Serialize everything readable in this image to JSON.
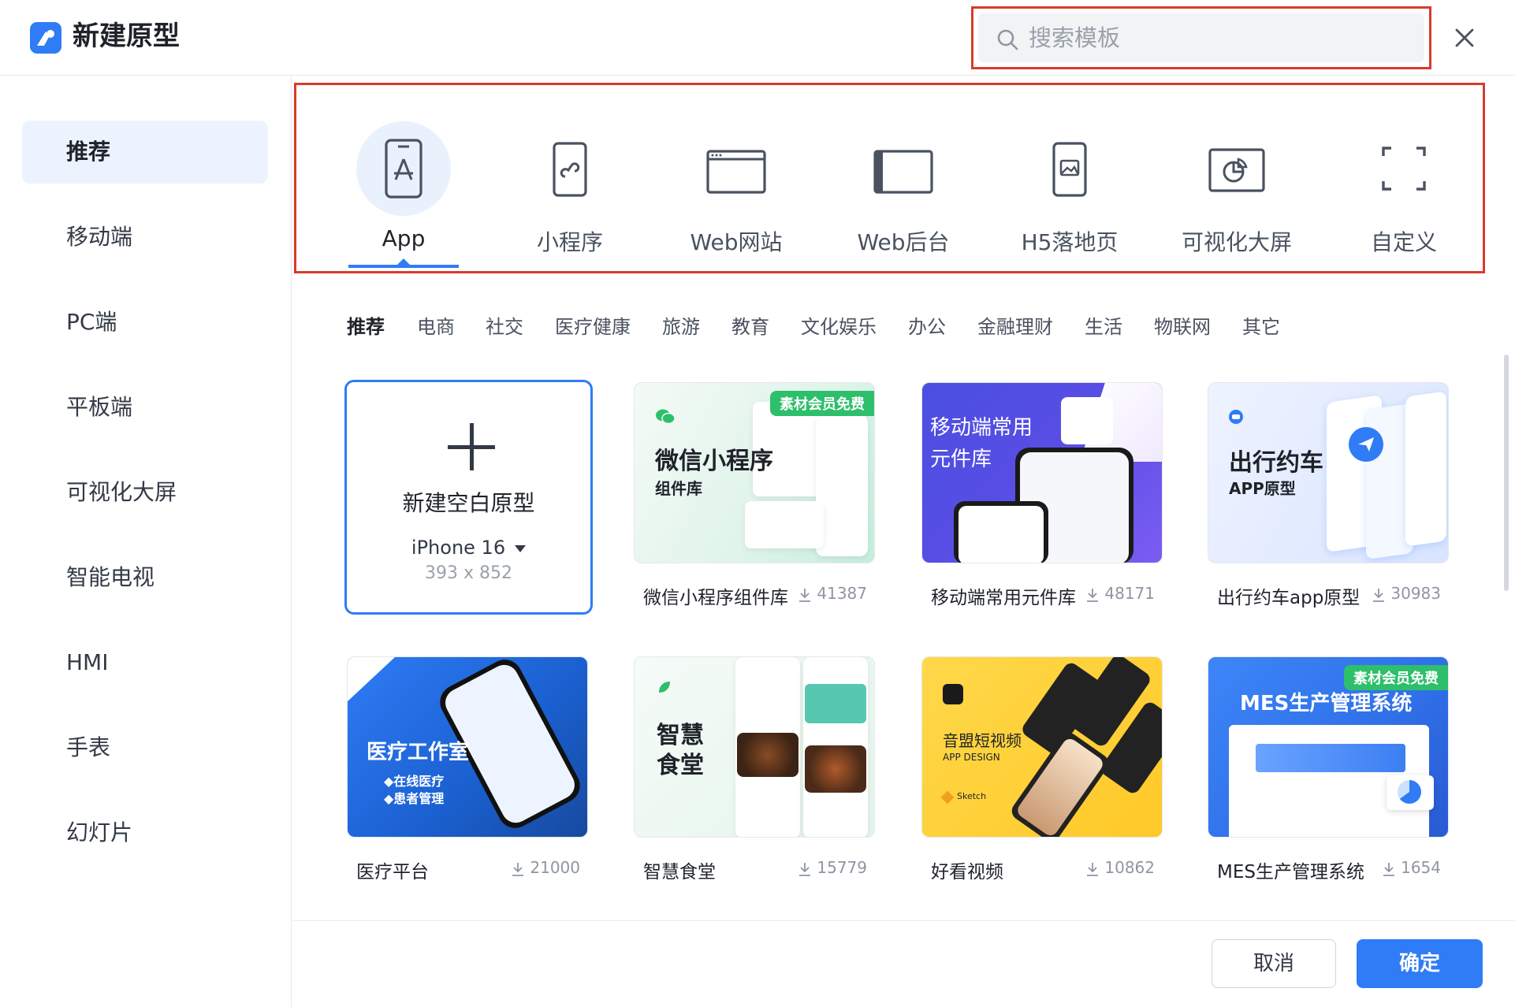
{
  "header": {
    "title": "新建原型",
    "search_placeholder": "搜索模板",
    "logo_icon": "app-logo-icon",
    "close_icon": "close-icon"
  },
  "sidebar": {
    "items": [
      {
        "label": "推荐",
        "active": true
      },
      {
        "label": "移动端"
      },
      {
        "label": "PC端"
      },
      {
        "label": "平板端"
      },
      {
        "label": "可视化大屏"
      },
      {
        "label": "智能电视"
      },
      {
        "label": "HMI"
      },
      {
        "label": "手表"
      },
      {
        "label": "幻灯片"
      }
    ]
  },
  "types": [
    {
      "label": "App",
      "icon": "app-store-icon",
      "active": true
    },
    {
      "label": "小程序",
      "icon": "mini-program-icon"
    },
    {
      "label": "Web网站",
      "icon": "web-window-icon"
    },
    {
      "label": "Web后台",
      "icon": "web-admin-icon"
    },
    {
      "label": "H5落地页",
      "icon": "image-phone-icon"
    },
    {
      "label": "可视化大屏",
      "icon": "chart-screen-icon"
    },
    {
      "label": "自定义",
      "icon": "custom-frame-icon"
    }
  ],
  "categories": [
    {
      "label": "推荐",
      "active": true
    },
    {
      "label": "电商"
    },
    {
      "label": "社交"
    },
    {
      "label": "医疗健康"
    },
    {
      "label": "旅游"
    },
    {
      "label": "教育"
    },
    {
      "label": "文化娱乐"
    },
    {
      "label": "办公"
    },
    {
      "label": "金融理财"
    },
    {
      "label": "生活"
    },
    {
      "label": "物联网"
    },
    {
      "label": "其它"
    }
  ],
  "new_card": {
    "title": "新建空白原型",
    "device": "iPhone 16",
    "size": "393 x 852"
  },
  "templates": [
    {
      "name": "微信小程序组件库",
      "downloads": "41387",
      "badge": "素材会员免费",
      "thumb_title": "微信小程序",
      "thumb_sub": "组件库"
    },
    {
      "name": "移动端常用元件库",
      "downloads": "48171",
      "thumb_title": "移动端常用",
      "thumb_sub": "元件库"
    },
    {
      "name": "出行约车app原型",
      "downloads": "30983",
      "thumb_title": "出行约车",
      "thumb_sub": "APP原型"
    },
    {
      "name": "医疗平台",
      "downloads": "21000",
      "thumb_title": "医疗工作室",
      "thumb_sub": "◆在线医疗",
      "thumb_sub2": "◆患者管理"
    },
    {
      "name": "智慧食堂",
      "downloads": "15779",
      "thumb_title": "智慧",
      "thumb_sub": "食堂"
    },
    {
      "name": "好看视频",
      "downloads": "10862",
      "thumb_title": "音盟短视频",
      "thumb_sub": "APP DESIGN",
      "thumb_sub2": "Sketch"
    },
    {
      "name": "MES生产管理系统",
      "downloads": "1654",
      "badge": "素材会员免费",
      "thumb_title": "MES生产管理系统"
    }
  ],
  "footer": {
    "cancel_label": "取消",
    "ok_label": "确定"
  },
  "colors": {
    "accent": "#2f7cf6",
    "highlight_box": "#d93a2b",
    "badge_green": "#2dbf6b"
  }
}
